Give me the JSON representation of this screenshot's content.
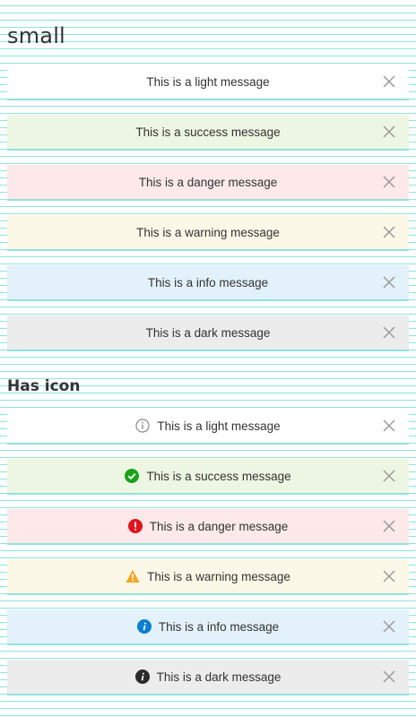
{
  "sections": {
    "small_title": "small",
    "icon_title": "Has icon"
  },
  "small": [
    {
      "variant": "light",
      "text": "This is a light message"
    },
    {
      "variant": "success",
      "text": "This is a success message"
    },
    {
      "variant": "danger",
      "text": "This is a danger message"
    },
    {
      "variant": "warning",
      "text": "This is a warning message"
    },
    {
      "variant": "info",
      "text": "This is a info message"
    },
    {
      "variant": "dark",
      "text": "This is a dark message"
    }
  ],
  "with_icon": [
    {
      "variant": "light",
      "icon": "info-outline-icon",
      "text": "This is a light message"
    },
    {
      "variant": "success",
      "icon": "check-circle-icon",
      "text": "This is a success message"
    },
    {
      "variant": "danger",
      "icon": "exclamation-circle-icon",
      "text": "This is a danger message"
    },
    {
      "variant": "warning",
      "icon": "warning-triangle-icon",
      "text": "This is a warning message"
    },
    {
      "variant": "info",
      "icon": "info-circle-icon",
      "text": "This is a info message"
    },
    {
      "variant": "dark",
      "icon": "info-circle-icon",
      "text": "This is a dark message"
    }
  ],
  "colors": {
    "success_icon": "#1aa31a",
    "danger_icon": "#e0141e",
    "warning_icon": "#f5a623",
    "info_icon": "#0b7fd1",
    "dark_icon": "#2b2b2b",
    "light_icon": "#8a8a8a",
    "close": "#9a9a9a",
    "guide_lines": "#8ee4dc"
  }
}
